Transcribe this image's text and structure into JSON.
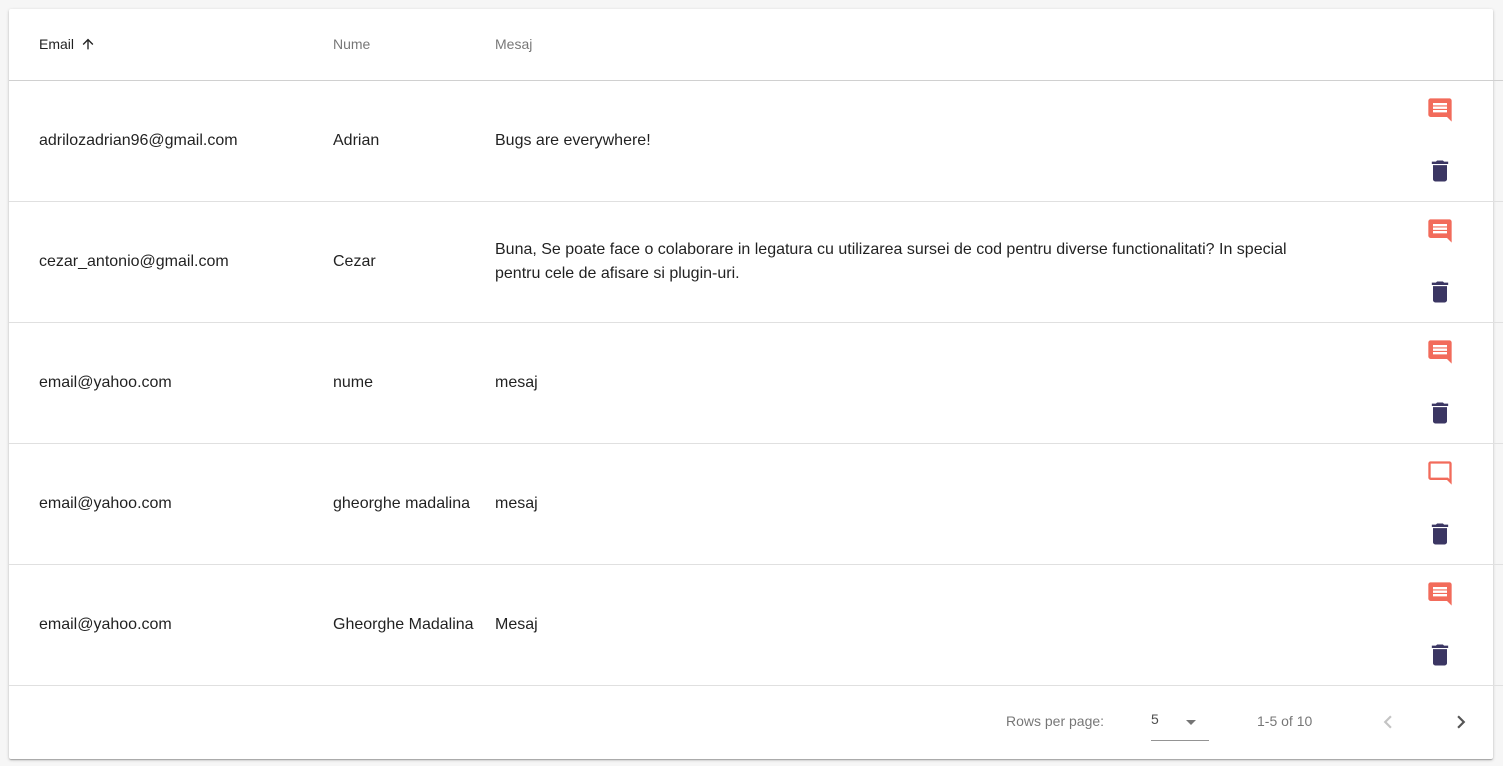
{
  "table": {
    "columns": [
      {
        "label": "Email",
        "sorted": "asc"
      },
      {
        "label": "Nume"
      },
      {
        "label": "Mesaj"
      }
    ],
    "rows": [
      {
        "email": "adrilozadrian96@gmail.com",
        "name": "Adrian",
        "message": "Bugs are everywhere!",
        "read": false
      },
      {
        "email": "cezar_antonio@gmail.com",
        "name": "Cezar",
        "message": "Buna, Se poate face o colaborare in legatura cu utilizarea sursei de cod pentru diverse functionalitati? In special pentru cele de afisare si plugin-uri.",
        "read": false
      },
      {
        "email": "email@yahoo.com",
        "name": "nume",
        "message": "mesaj",
        "read": false
      },
      {
        "email": "email@yahoo.com",
        "name": "gheorghe madalina",
        "message": "mesaj",
        "read": true
      },
      {
        "email": "email@yahoo.com",
        "name": "Gheorghe Madalina",
        "message": "Mesaj",
        "read": false
      }
    ]
  },
  "pagination": {
    "rows_per_page_label": "Rows per page:",
    "rows_per_page": "5",
    "range": "1-5 of 10"
  },
  "icons": {
    "sort": "arrow-up-icon",
    "comment_filled": "comment-filled-icon",
    "comment_outline": "comment-outline-icon",
    "delete": "trash-icon",
    "dropdown": "caret-down-icon",
    "prev": "chevron-left-icon",
    "next": "chevron-right-icon"
  },
  "colors": {
    "comment": "#f26b5b",
    "delete": "#3b3663",
    "nav_disabled": "#c4c4c4",
    "nav_enabled": "#555555"
  }
}
